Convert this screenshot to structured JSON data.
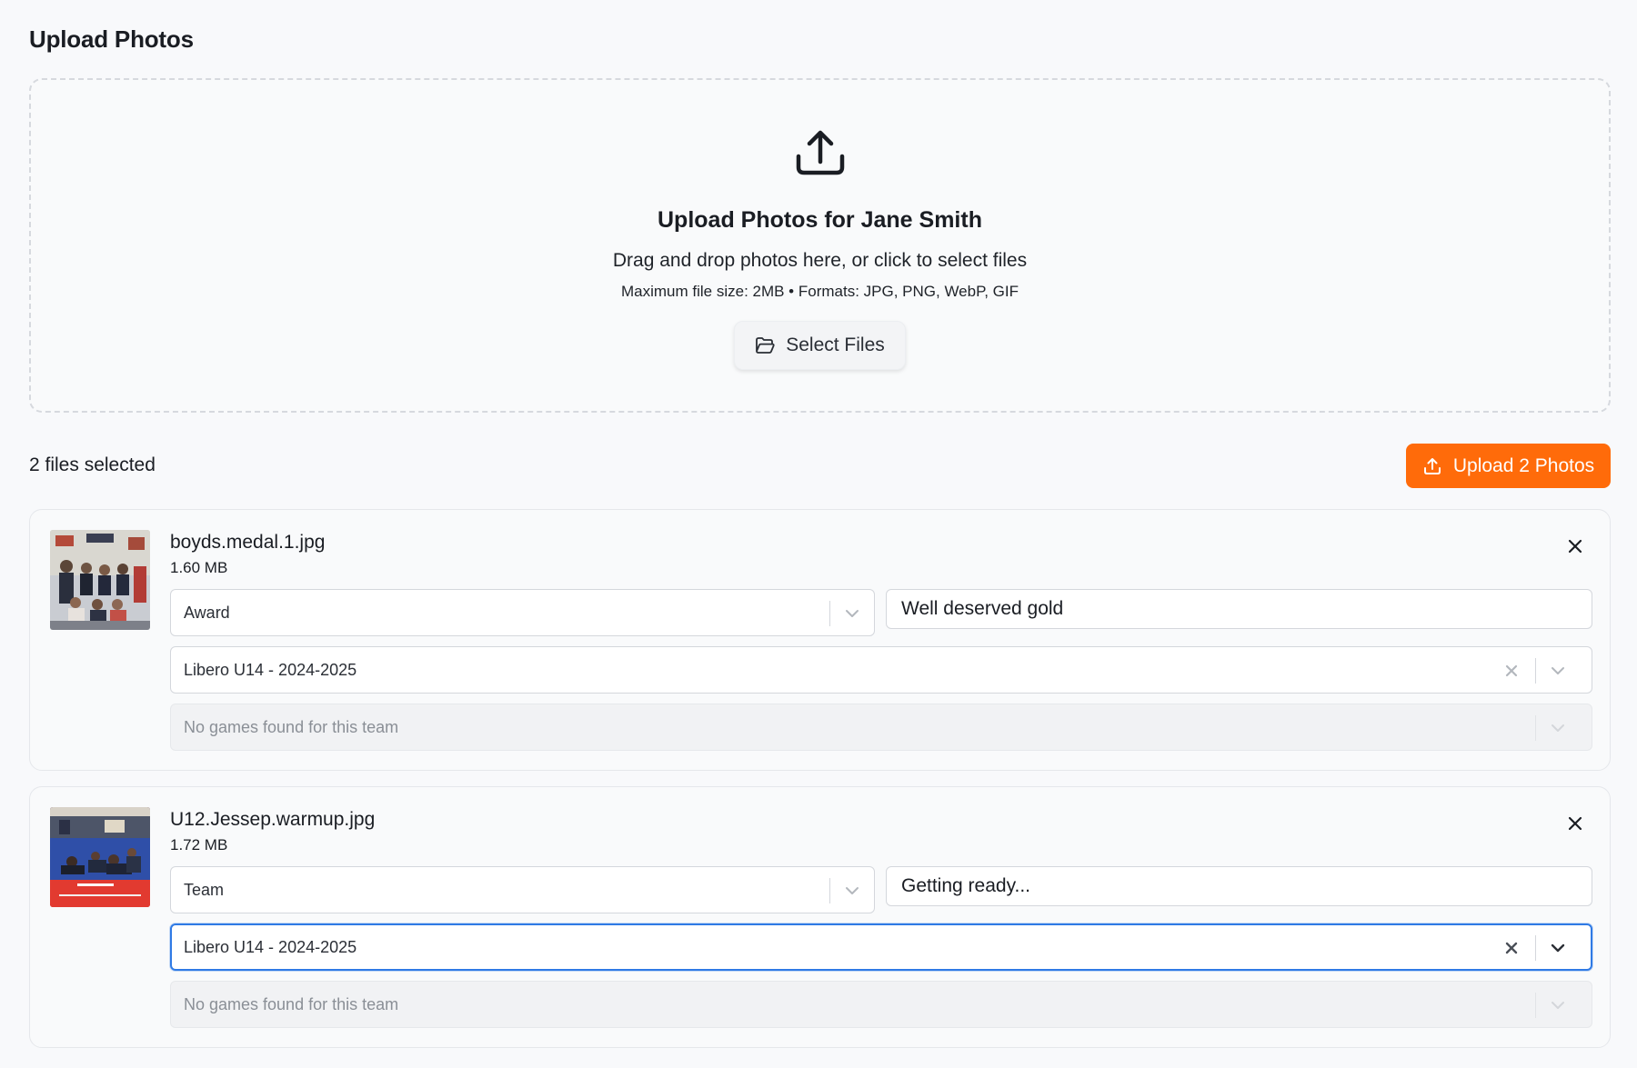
{
  "page": {
    "title": "Upload Photos"
  },
  "dropzone": {
    "title": "Upload Photos for Jane Smith",
    "subtitle": "Drag and drop photos here, or click to select files",
    "formats": "Maximum file size: 2MB • Formats: JPG, PNG, WebP, GIF",
    "select_button": "Select Files",
    "icon": "upload-tray-icon"
  },
  "summary": {
    "files_selected": "2 files selected",
    "upload_button": "Upload 2 Photos"
  },
  "files": [
    {
      "name": "boyds.medal.1.jpg",
      "size": "1.60 MB",
      "category": "Award",
      "caption": "Well deserved gold",
      "team": "Libero U14 - 2024-2025",
      "game_placeholder": "No games found for this team"
    },
    {
      "name": "U12.Jessep.warmup.jpg",
      "size": "1.72 MB",
      "category": "Team",
      "caption": "Getting ready...",
      "team": "Libero U14 - 2024-2025",
      "game_placeholder": "No games found for this team"
    }
  ],
  "colors": {
    "accent": "#ff6b0a",
    "focus": "#2f7ae5",
    "background": "#f8f9fb"
  }
}
